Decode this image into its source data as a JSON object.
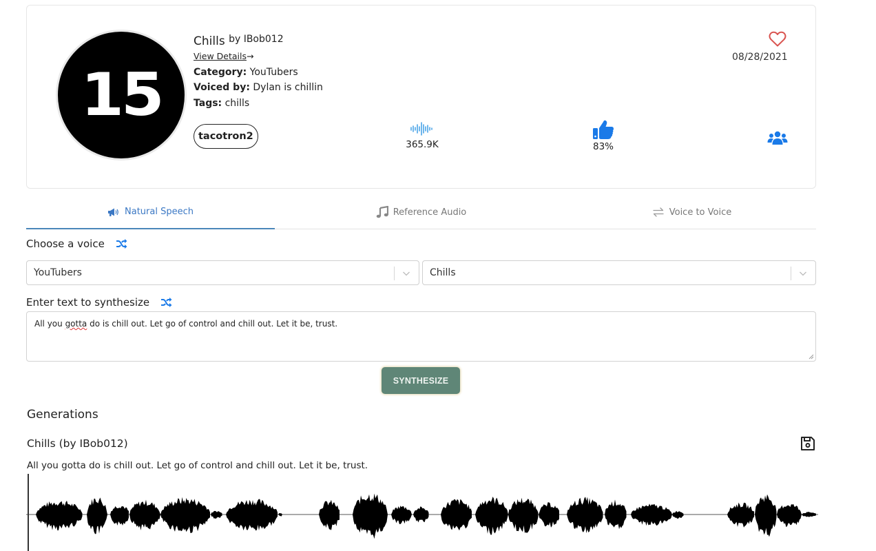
{
  "voice_card": {
    "avatar_text": "15",
    "title": "Chills",
    "by_label": "by IBob012",
    "view_details": "View Details",
    "view_details_arrow": "→",
    "category_label": "Category:",
    "category_value": "YouTubers",
    "voiced_by_label": "Voiced by:",
    "voiced_by_value": "Dylan is chillin",
    "tags_label": "Tags:",
    "tags_value": "chills",
    "model": "tacotron2",
    "plays": "365.9K",
    "like_percent": "83%",
    "date": "08/28/2021",
    "icons": {
      "favorite": "heart-outline-icon",
      "plays": "sound-wave-icon",
      "likes": "thumbs-up-icon",
      "community": "users-icon"
    },
    "colors": {
      "heart": "#d9534f",
      "stat_icons": "#1a7ae8",
      "wave_icon": "#4aa3e8"
    }
  },
  "tabs": [
    {
      "label": "Natural Speech",
      "icon": "megaphone-icon",
      "active": true
    },
    {
      "label": "Reference Audio",
      "icon": "music-note-icon",
      "active": false
    },
    {
      "label": "Voice to Voice",
      "icon": "swap-arrows-icon",
      "active": false
    }
  ],
  "form": {
    "choose_voice_label": "Choose a voice",
    "category_select": "YouTubers",
    "voice_select": "Chills",
    "text_label": "Enter text to synthesize",
    "text_before": "All you ",
    "text_misspelled": "gotta",
    "text_after": " do is chill out. Let go of control and chill out. Let it be, trust.",
    "synthesize_button": "SYNTHESIZE",
    "colors": {
      "accent": "#1a7ae8",
      "button": "#5f8677"
    }
  },
  "generations": {
    "title": "Generations",
    "items": [
      {
        "name": "Chills (by IBob012)",
        "text": "All you gotta do is chill out. Let go of control and chill out. Let it be, trust.",
        "save_icon": "floppy-disk-icon",
        "playback_position": 0
      }
    ]
  }
}
